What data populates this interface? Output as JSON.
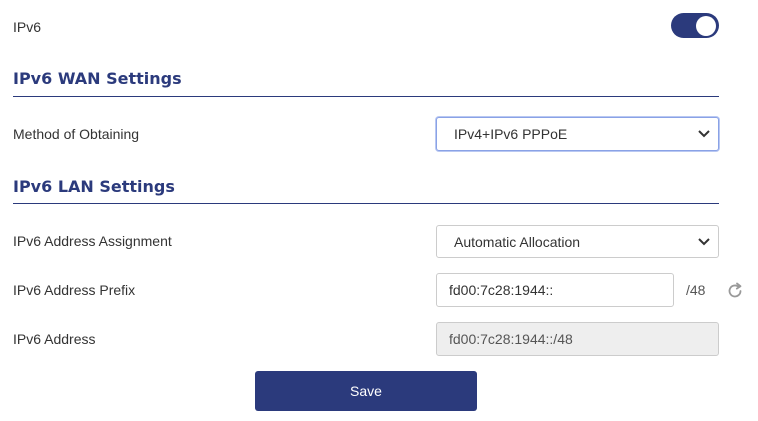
{
  "ipv6": {
    "label": "IPv6",
    "enabled": true
  },
  "wan": {
    "title": "IPv6 WAN Settings",
    "method": {
      "label": "Method of Obtaining",
      "value": "IPv4+IPv6 PPPoE"
    }
  },
  "lan": {
    "title": "IPv6 LAN Settings",
    "assignment": {
      "label": "IPv6 Address Assignment",
      "value": "Automatic Allocation"
    },
    "prefix": {
      "label": "IPv6 Address Prefix",
      "value": "fd00:7c28:1944::",
      "suffix": "/48"
    },
    "address": {
      "label": "IPv6 Address",
      "value": "fd00:7c28:1944::/48"
    }
  },
  "save_label": "Save",
  "colors": {
    "accent": "#2b3a7c",
    "border": "#cccccc",
    "disabled_bg": "#eeeeee"
  }
}
